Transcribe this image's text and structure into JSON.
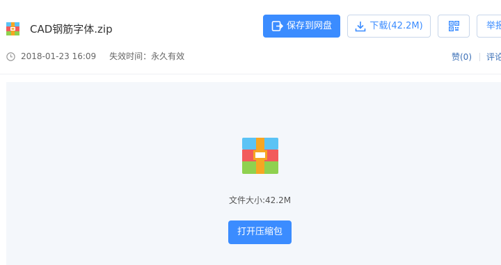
{
  "file": {
    "name": "CAD钢筋字体.zip",
    "date": "2018-01-23 16:09",
    "expire_label": "失效时间：",
    "expire_value": "永久有效",
    "size_text": "文件大小:42.2M"
  },
  "toolbar": {
    "save_label": "保存到网盘",
    "download_label": "下载(42.2M)",
    "report_label": "举报"
  },
  "actions": {
    "like_label": "赞(0)",
    "comment_label": "评论"
  },
  "preview": {
    "open_label": "打开压缩包"
  },
  "colors": {
    "accent": "#3b8cff",
    "panel_bg": "#f4f7fb",
    "zip_blue": "#5bc3f5",
    "zip_red": "#f25b5b",
    "zip_green": "#8fd14f",
    "zip_orange": "#f6a623"
  },
  "icons": {
    "file": "zip-file-icon",
    "save": "save-to-cloud-icon",
    "download": "download-icon",
    "qr": "qr-code-icon",
    "clock": "clock-icon"
  }
}
